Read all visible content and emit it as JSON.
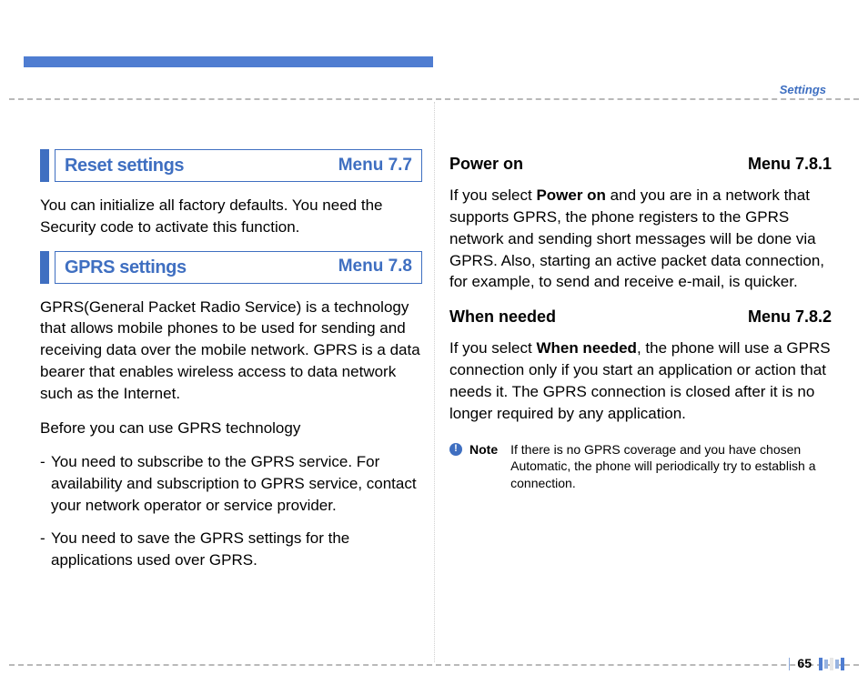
{
  "header": {
    "section_label": "Settings"
  },
  "left": {
    "s1": {
      "title": "Reset settings",
      "menu": "Menu 7.7",
      "body": "You can initialize all factory defaults. You need the Security code to activate this function."
    },
    "s2": {
      "title": "GPRS settings",
      "menu": "Menu 7.8",
      "body": "GPRS(General Packet Radio Service) is a technology that allows mobile phones to be used for sending and receiving data over the mobile network. GPRS is a data bearer that enables wireless access to data network such as the Internet.",
      "lead": "Before you can use GPRS technology",
      "bullets": [
        "You need to subscribe to the GPRS service. For availability and subscription to GPRS service, contact your network operator or service provider.",
        "You need to save the GPRS settings for the applications used over GPRS."
      ]
    }
  },
  "right": {
    "h1": {
      "title": "Power on",
      "menu": "Menu 7.8.1"
    },
    "p1a": "If you select ",
    "p1b": "Power on",
    "p1c": " and you are in a network that supports GPRS, the phone registers to the GPRS network and sending short messages will be done via GPRS. Also, starting an active packet data connection, for example, to send and receive e-mail, is quicker.",
    "h2": {
      "title": "When needed",
      "menu": "Menu 7.8.2"
    },
    "p2a": "If you select ",
    "p2b": "When needed",
    "p2c": ", the phone will use a GPRS connection only if you start an application or action that needs it. The GPRS connection is closed after it is no longer required by any application.",
    "note_label": "Note",
    "note_body": "If there is no GPRS coverage and you have chosen Automatic, the phone will periodically try to establish a connection."
  },
  "page_number": "65"
}
